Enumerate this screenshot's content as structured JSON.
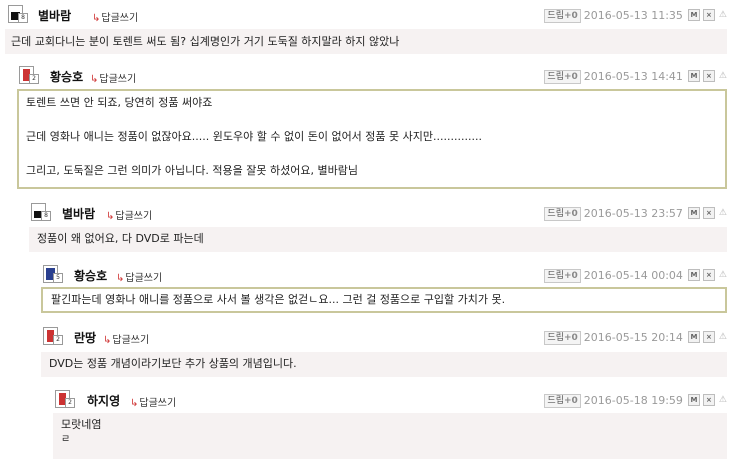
{
  "comments": [
    {
      "author": "별바람",
      "reply_label": "답글쓰기",
      "recommend_label": "드립",
      "recommend_count": "+0",
      "date": "2016-05-13 11:35",
      "level": "8",
      "lines": [
        "근데 교회다니는 분이 토렌트 써도 됨? 십계명인가 거기 도둑질 하지말라 하지 않았나"
      ]
    },
    {
      "author": "황승호",
      "reply_label": "답글쓰기",
      "recommend_label": "드립",
      "recommend_count": "+0",
      "date": "2016-05-13 14:41",
      "level": "2",
      "lines": [
        "토렌트 쓰면 안 되죠, 당연히 정품 써야죠",
        "근데 영화나 애니는 정품이 없잖아요..... 윈도우야 할 수 없이 돈이 없어서 정품 못 사지만..............",
        "그리고, 도둑질은 그런 의미가 아닙니다. 적용을 잘못 하셨어요, 별바람님"
      ]
    },
    {
      "author": "별바람",
      "reply_label": "답글쓰기",
      "recommend_label": "드립",
      "recommend_count": "+0",
      "date": "2016-05-13 23:57",
      "level": "8",
      "lines": [
        "정품이 왜 없어요, 다 DVD로 파는데"
      ]
    },
    {
      "author": "황승호",
      "reply_label": "답글쓰기",
      "recommend_label": "드립",
      "recommend_count": "+0",
      "date": "2016-05-14 00:04",
      "level": "5",
      "lines": [
        "팔긴파는데 영화나 애니를 정품으로 사서 볼 생각은 없걷ㄴ요... 그런 걸 정품으로 구입할 가치가 못."
      ]
    },
    {
      "author": "란땅",
      "reply_label": "답글쓰기",
      "recommend_label": "드립",
      "recommend_count": "+0",
      "date": "2016-05-15 20:14",
      "level": "2",
      "lines": [
        "DVD는 정품 개념이라기보단 추가 상품의 개념입니다."
      ]
    },
    {
      "author": "하지영",
      "reply_label": "답글쓰기",
      "recommend_label": "드립",
      "recommend_count": "+0",
      "date": "2016-05-18 19:59",
      "level": "2",
      "lines": [
        "모랏네염",
        "ㄹ"
      ]
    }
  ],
  "icons": {
    "message": "M",
    "delete": "×",
    "report": "⚠"
  },
  "colors": {
    "content_bg": "#f6f2f2",
    "highlight_border": "#c9c79b",
    "reply_arrow": "#d03838",
    "date": "#9a9a9a"
  }
}
